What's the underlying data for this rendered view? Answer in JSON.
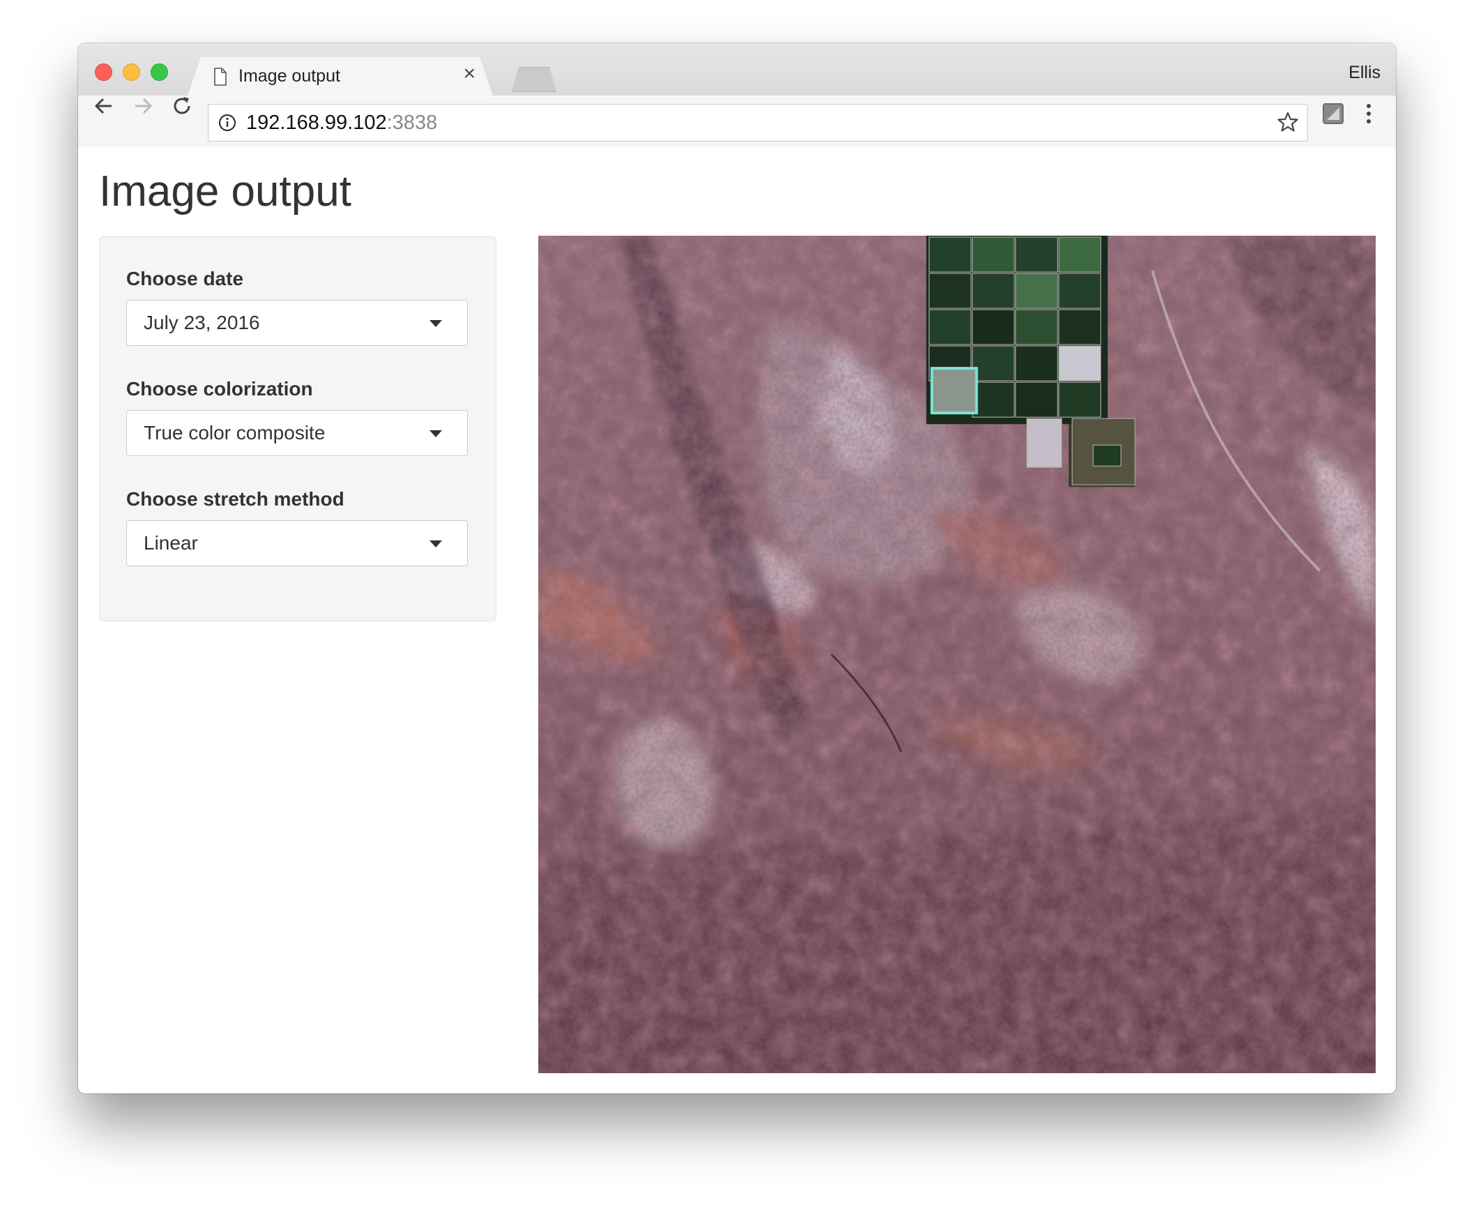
{
  "browser": {
    "tab_title": "Image output",
    "tab_close": "×",
    "profile_name": "Ellis",
    "url_host": "192.168.99.102",
    "url_port": ":3838",
    "icons": [
      "back-icon",
      "forward-icon",
      "reload-icon",
      "info-icon",
      "star-icon",
      "extension-icon",
      "menu-icon",
      "page-icon",
      "close-icon"
    ]
  },
  "page": {
    "title": "Image output"
  },
  "controls": [
    {
      "label": "Choose date",
      "value": "July 23, 2016"
    },
    {
      "label": "Choose colorization",
      "value": "True color composite"
    },
    {
      "label": "Choose stretch method",
      "value": "Linear"
    }
  ],
  "colors": {
    "traffic_red": "#fc605b",
    "traffic_yellow": "#fdbc40",
    "traffic_green": "#34c84a",
    "panel_bg": "#f5f5f5",
    "text": "#333333"
  }
}
